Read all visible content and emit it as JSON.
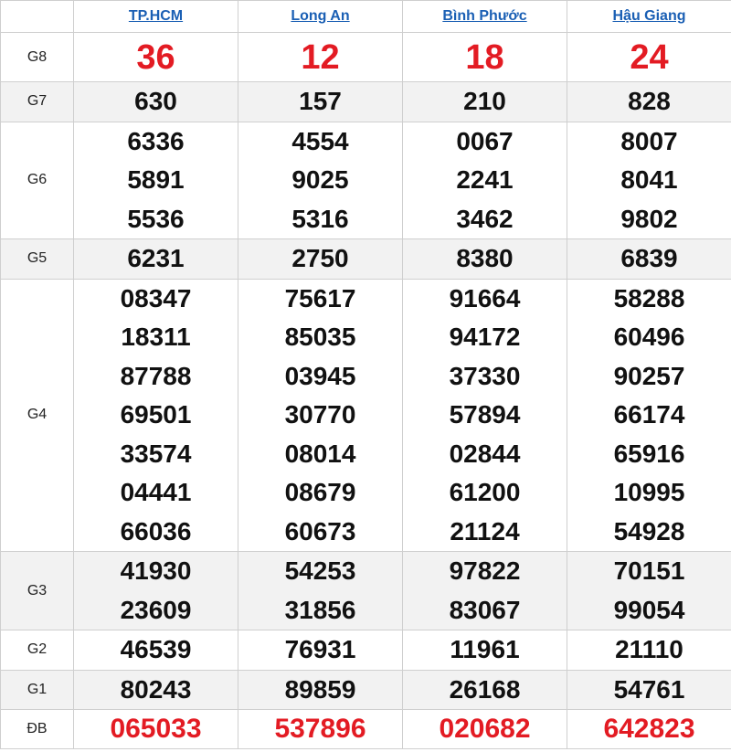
{
  "provinces": [
    "TP.HCM",
    "Long An",
    "Bình Phước",
    "Hậu Giang"
  ],
  "colors": {
    "link": "#1a5fb4",
    "highlight": "#e31b23",
    "alt_row": "#f2f2f2"
  },
  "prizes": [
    {
      "label": "G8",
      "values": [
        [
          "36"
        ],
        [
          "12"
        ],
        [
          "18"
        ],
        [
          "24"
        ]
      ]
    },
    {
      "label": "G7",
      "values": [
        [
          "630"
        ],
        [
          "157"
        ],
        [
          "210"
        ],
        [
          "828"
        ]
      ]
    },
    {
      "label": "G6",
      "values": [
        [
          "6336",
          "5891",
          "5536"
        ],
        [
          "4554",
          "9025",
          "5316"
        ],
        [
          "0067",
          "2241",
          "3462"
        ],
        [
          "8007",
          "8041",
          "9802"
        ]
      ]
    },
    {
      "label": "G5",
      "values": [
        [
          "6231"
        ],
        [
          "2750"
        ],
        [
          "8380"
        ],
        [
          "6839"
        ]
      ]
    },
    {
      "label": "G4",
      "values": [
        [
          "08347",
          "18311",
          "87788",
          "69501",
          "33574",
          "04441",
          "66036"
        ],
        [
          "75617",
          "85035",
          "03945",
          "30770",
          "08014",
          "08679",
          "60673"
        ],
        [
          "91664",
          "94172",
          "37330",
          "57894",
          "02844",
          "61200",
          "21124"
        ],
        [
          "58288",
          "60496",
          "90257",
          "66174",
          "65916",
          "10995",
          "54928"
        ]
      ]
    },
    {
      "label": "G3",
      "values": [
        [
          "41930",
          "23609"
        ],
        [
          "54253",
          "31856"
        ],
        [
          "97822",
          "83067"
        ],
        [
          "70151",
          "99054"
        ]
      ]
    },
    {
      "label": "G2",
      "values": [
        [
          "46539"
        ],
        [
          "76931"
        ],
        [
          "11961"
        ],
        [
          "21110"
        ]
      ]
    },
    {
      "label": "G1",
      "values": [
        [
          "80243"
        ],
        [
          "89859"
        ],
        [
          "26168"
        ],
        [
          "54761"
        ]
      ]
    },
    {
      "label": "ĐB",
      "values": [
        [
          "065033"
        ],
        [
          "537896"
        ],
        [
          "020682"
        ],
        [
          "642823"
        ]
      ]
    }
  ]
}
